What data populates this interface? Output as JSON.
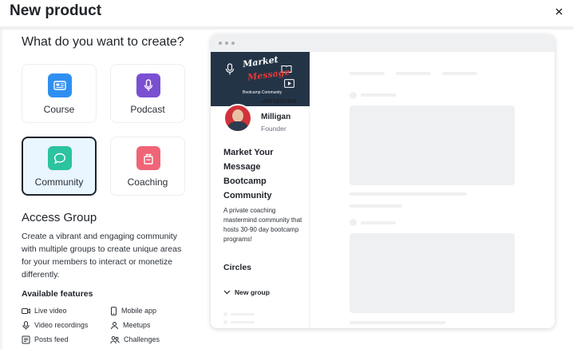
{
  "header": {
    "title": "New product",
    "close_symbol": "×"
  },
  "create": {
    "heading": "What do you want to create?",
    "types": [
      {
        "label": "Course",
        "icon": "course-icon",
        "color": "#2f8ff0"
      },
      {
        "label": "Podcast",
        "icon": "microphone-icon",
        "color": "#7b4fd1"
      },
      {
        "label": "Community",
        "icon": "chat-bubble-icon",
        "color": "#2bc3a0",
        "selected": true
      },
      {
        "label": "Coaching",
        "icon": "coaching-icon",
        "color": "#f06477"
      }
    ]
  },
  "group": {
    "title": "Access Group",
    "description": "Create a vibrant and engaging community with multiple groups to create unique areas for your members to interact or monetize differently.",
    "features_title": "Available features",
    "features": [
      {
        "label": "Live video",
        "icon": "video-icon"
      },
      {
        "label": "Mobile app",
        "icon": "mobile-icon"
      },
      {
        "label": "Video recordings",
        "icon": "microphone-icon"
      },
      {
        "label": "Meetups",
        "icon": "meetups-icon"
      },
      {
        "label": "Posts feed",
        "icon": "posts-icon"
      },
      {
        "label": "Challenges",
        "icon": "challenges-icon"
      }
    ]
  },
  "preview": {
    "banner_line1": "Market",
    "banner_line2": "Message",
    "banner_line3": "Bootcamp Community",
    "owner_first": "Jonathan",
    "owner_last": "Milligan",
    "owner_role": "Founder",
    "community_name": "Market Your Message Bootcamp Community",
    "community_description": "A private coaching mastermind community that hosts 30-90 day bootcamp programs!",
    "circles_label": "Circles",
    "new_group_label": "New group"
  },
  "colors": {
    "selected_border": "#1f2329",
    "selected_bg": "#e9f5ff",
    "banner_bg": "#243447",
    "avatar_bg": "#d1333a"
  }
}
